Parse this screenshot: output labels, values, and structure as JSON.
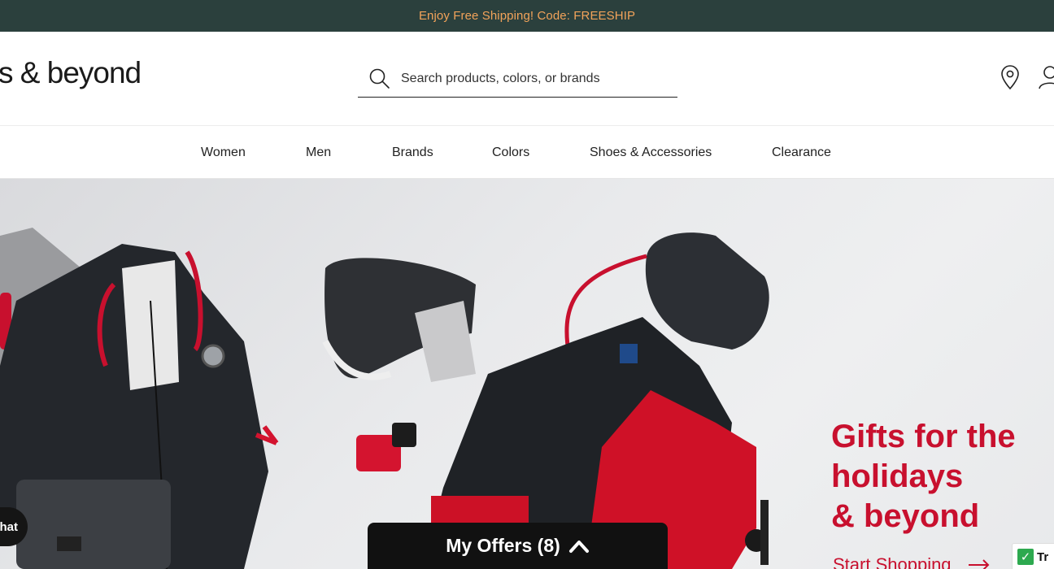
{
  "promo": {
    "text": "Enjoy Free Shipping! Code: FREESHIP"
  },
  "header": {
    "logo": "s & beyond",
    "search_placeholder": "Search products, colors, or brands"
  },
  "nav": {
    "items": [
      "Women",
      "Men",
      "Brands",
      "Colors",
      "Shoes & Accessories",
      "Clearance"
    ]
  },
  "hero": {
    "title": "Gifts for the\nholidays\n& beyond",
    "cta": "Start Shopping"
  },
  "floating": {
    "offers": "My Offers (8)",
    "chat": "hat",
    "trust": "Tr"
  },
  "colors": {
    "promo_bg": "#2b403d",
    "promo_text": "#f2a35a",
    "brand_red": "#c8102e"
  },
  "icons": [
    "search-icon",
    "location-pin-icon",
    "account-icon",
    "chevron-up-icon",
    "arrow-right-icon",
    "check-icon"
  ]
}
